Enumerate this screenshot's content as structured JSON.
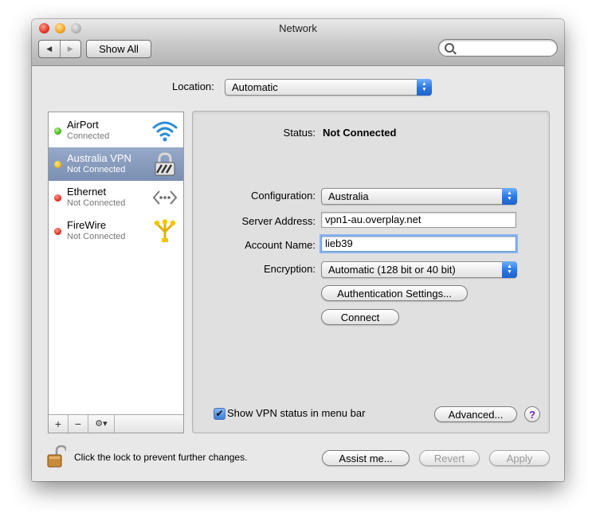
{
  "window": {
    "title": "Network"
  },
  "toolbar": {
    "back": "◀",
    "forward": "▶",
    "show_all": "Show All",
    "search_value": ""
  },
  "location": {
    "label": "Location:",
    "value": "Automatic"
  },
  "sidebar": {
    "services": [
      {
        "name": "AirPort",
        "status": "Connected",
        "status_color": "#3db116",
        "icon": "wifi-icon"
      },
      {
        "name": "Australia VPN",
        "status": "Not Connected",
        "status_color": "#f0b418",
        "icon": "vpn-lock-icon"
      },
      {
        "name": "Ethernet",
        "status": "Not Connected",
        "status_color": "#e0261a",
        "icon": "ethernet-icon"
      },
      {
        "name": "FireWire",
        "status": "Not Connected",
        "status_color": "#e0261a",
        "icon": "firewire-icon"
      }
    ],
    "add": "+",
    "remove": "−",
    "gear": "⚙▾"
  },
  "detail": {
    "status_label": "Status:",
    "status_value": "Not Connected",
    "configuration_label": "Configuration:",
    "configuration_value": "Australia",
    "server_label": "Server Address:",
    "server_value": "vpn1-au.overplay.net",
    "account_label": "Account Name:",
    "account_value": "lieb39",
    "encryption_label": "Encryption:",
    "encryption_value": "Automatic (128 bit or 40 bit)",
    "auth_button": "Authentication Settings...",
    "connect_button": "Connect",
    "show_vpn_label": "Show VPN status in menu bar",
    "show_vpn_checked": true,
    "advanced_button": "Advanced...",
    "help_button": "?"
  },
  "footer": {
    "lock_text": "Click the lock to prevent further changes.",
    "assist_button": "Assist me...",
    "revert_button": "Revert",
    "apply_button": "Apply"
  }
}
